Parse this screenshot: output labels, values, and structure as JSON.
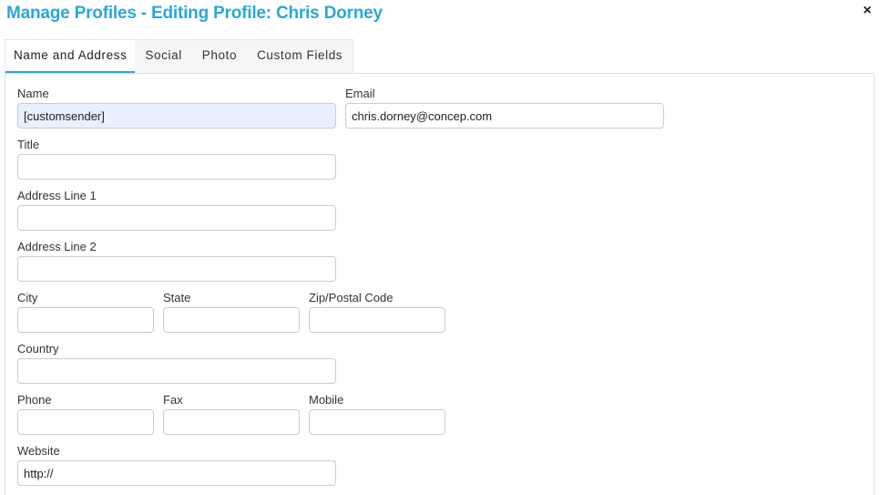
{
  "dialog": {
    "title": "Manage Profiles - Editing Profile: Chris Dorney",
    "close_glyph": "×",
    "close_icon": "close-icon"
  },
  "tabs": [
    {
      "label": "Name and Address",
      "active": true
    },
    {
      "label": "Social",
      "active": false
    },
    {
      "label": "Photo",
      "active": false
    },
    {
      "label": "Custom Fields",
      "active": false
    }
  ],
  "colors": {
    "accent": "#2aa7db",
    "autofill_background": "#e8f0fe"
  },
  "form": {
    "name": {
      "label": "Name",
      "value": "[customsender]"
    },
    "email": {
      "label": "Email",
      "value": "chris.dorney@concep.com"
    },
    "title": {
      "label": "Title",
      "value": ""
    },
    "address1": {
      "label": "Address Line 1",
      "value": ""
    },
    "address2": {
      "label": "Address Line 2",
      "value": ""
    },
    "city": {
      "label": "City",
      "value": ""
    },
    "state": {
      "label": "State",
      "value": ""
    },
    "zip": {
      "label": "Zip/Postal Code",
      "value": ""
    },
    "country": {
      "label": "Country",
      "value": ""
    },
    "phone": {
      "label": "Phone",
      "value": ""
    },
    "fax": {
      "label": "Fax",
      "value": ""
    },
    "mobile": {
      "label": "Mobile",
      "value": ""
    },
    "website": {
      "label": "Website",
      "value": "http://"
    }
  }
}
